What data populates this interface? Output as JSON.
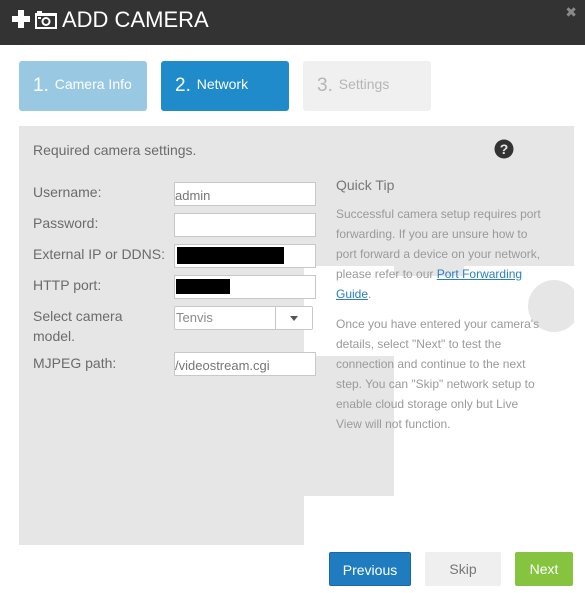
{
  "header": {
    "title": "ADD CAMERA",
    "close_icon": "close-icon",
    "plus_icon": "plus-icon",
    "camera_icon": "camera-icon"
  },
  "steps": [
    {
      "number": "1.",
      "label": "Camera Info",
      "state": "completed"
    },
    {
      "number": "2.",
      "label": "Network",
      "state": "active"
    },
    {
      "number": "3.",
      "label": "Settings",
      "state": "disabled"
    }
  ],
  "panel": {
    "required_text": "Required camera settings.",
    "help_icon": "question-circle-icon"
  },
  "form": {
    "username": {
      "label": "Username:",
      "placeholder": "admin",
      "value": ""
    },
    "password": {
      "label": "Password:",
      "value": ""
    },
    "external_ip": {
      "label": "External IP or DDNS:",
      "value": "[redacted]"
    },
    "http_port": {
      "label": "HTTP port:",
      "value": "[redacted]"
    },
    "camera_model": {
      "label_line1": "Select camera",
      "label_line2": "model.",
      "selected": "Tenvis"
    },
    "mjpeg_path": {
      "label": "MJPEG path:",
      "placeholder": "/videostream.cgi",
      "value": ""
    }
  },
  "quick_tip": {
    "title": "Quick Tip",
    "p1_text": "Successful camera setup requires port forwarding. If you are unsure how to port forward a device on your network, please refer to our ",
    "p1_link": "Port Forwarding Guide",
    "p1_end": ".",
    "p2": "Once you have entered your camera's details, select \"Next\" to test the connection and continue to the next step. You can \"Skip\" network setup to enable cloud storage only but Live View will not function."
  },
  "buttons": {
    "previous": "Previous",
    "skip": "Skip",
    "next": "Next"
  },
  "colors": {
    "header_bg": "#333333",
    "step_completed": "#99c9e2",
    "step_active": "#1f8bca",
    "step_disabled": "#f0f0f0",
    "panel_bg": "#e6e6e6",
    "previous_btn": "#1f7dbf",
    "next_btn": "#86c440",
    "link": "#2a7fc0"
  }
}
